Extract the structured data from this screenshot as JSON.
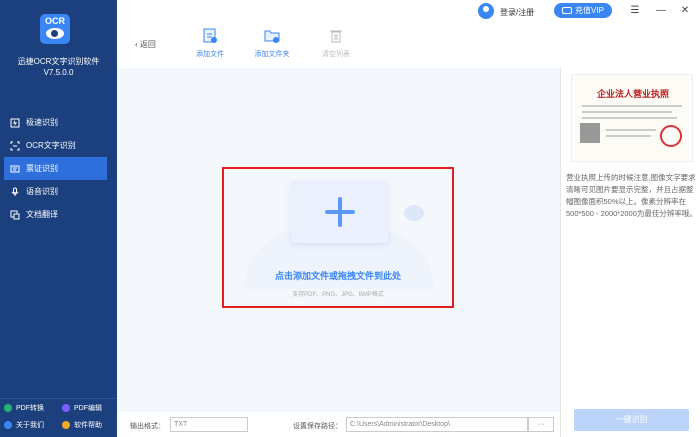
{
  "app": {
    "logo_text": "OCR",
    "title": "迅捷OCR文字识别软件",
    "version": "V7.5.0.0"
  },
  "sidebar": {
    "items": [
      {
        "label": "极速识别",
        "icon": "lightning-icon",
        "active": false
      },
      {
        "label": "OCR文字识别",
        "icon": "scan-icon",
        "active": false
      },
      {
        "label": "票证识别",
        "icon": "ticket-icon",
        "active": true
      },
      {
        "label": "语音识别",
        "icon": "microphone-icon",
        "active": false
      },
      {
        "label": "文档翻译",
        "icon": "translate-icon",
        "active": false
      }
    ],
    "footer": [
      {
        "label": "PDF转换",
        "icon": "pdf-convert-icon",
        "color": "#22b573"
      },
      {
        "label": "PDF编辑",
        "icon": "pdf-edit-icon",
        "color": "#7b61ff"
      },
      {
        "label": "关于我们",
        "icon": "info-icon",
        "color": "#3a86f5"
      },
      {
        "label": "软件帮助",
        "icon": "help-icon",
        "color": "#f5a623"
      }
    ]
  },
  "topbar": {
    "login_label": "登录/注册",
    "vip_label": "充值VIP"
  },
  "toolbar": {
    "back_label": "返回",
    "add_file_label": "添加文件",
    "add_folder_label": "添加文件夹",
    "clear_list_label": "清空列表"
  },
  "dropzone": {
    "main_text": "点击添加文件或拖拽文件到此处",
    "sub_text": "支持PDF、PNG、JPG、BMP格式"
  },
  "bottombar": {
    "output_format_label": "输出格式：",
    "output_format_value": "TXT",
    "save_path_label": "设置保存路径：",
    "save_path_value": "C:\\Users\\Administrator\\Desktop\\",
    "browse_label": "···"
  },
  "right_panel": {
    "license_title": "企业法人营业执照",
    "description": "营业执照上传的时候注意,图像文字要求清晰可见图片要显示完整，并且占据整幅图像面积50%以上。像素分辨率在500*500 - 2000*2000为最佳分辨率哦。",
    "recognize_label": "一键识别"
  },
  "colors": {
    "sidebar_bg": "#1c3f7d",
    "accent": "#3a86f5",
    "highlight_border": "#e02020"
  }
}
